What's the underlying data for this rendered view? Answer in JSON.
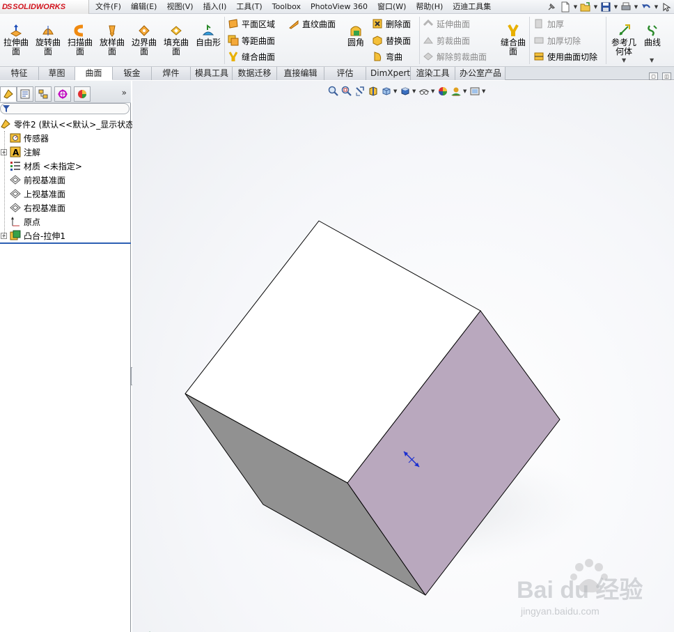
{
  "app": {
    "brand_prefix": "DS",
    "brand_name": "SOLIDWORKS"
  },
  "menus": [
    "文件(F)",
    "编辑(E)",
    "视图(V)",
    "插入(I)",
    "工具(T)",
    "Toolbox",
    "PhotoView 360",
    "窗口(W)",
    "帮助(H)",
    "迈迪工具集"
  ],
  "ribbon": {
    "big_buttons": [
      {
        "label": "拉伸曲面",
        "icon": "extruded-surface-icon"
      },
      {
        "label": "旋转曲面",
        "icon": "revolved-surface-icon"
      },
      {
        "label": "扫描曲面",
        "icon": "swept-surface-icon"
      },
      {
        "label": "放样曲面",
        "icon": "lofted-surface-icon"
      },
      {
        "label": "边界曲面",
        "icon": "boundary-surface-icon"
      },
      {
        "label": "填充曲面",
        "icon": "filled-surface-icon"
      },
      {
        "label": "自由形",
        "icon": "freeform-icon"
      }
    ],
    "group2": [
      {
        "label": "平面区域",
        "icon": "planar-surface-icon"
      },
      {
        "label": "等距曲面",
        "icon": "offset-surface-icon"
      },
      {
        "label": "缝合曲面",
        "icon": "knit-surface-icon"
      }
    ],
    "ruled_surface": "直纹曲面",
    "fillet": "圆角",
    "group3": [
      {
        "label": "删除面",
        "icon": "delete-face-icon"
      },
      {
        "label": "替换面",
        "icon": "replace-face-icon"
      },
      {
        "label": "弯曲",
        "icon": "flex-icon"
      }
    ],
    "group4": [
      {
        "label": "延伸曲面",
        "icon": "extend-surface-icon"
      },
      {
        "label": "剪裁曲面",
        "icon": "trim-surface-icon"
      },
      {
        "label": "解除剪裁曲面",
        "icon": "untrim-surface-icon"
      }
    ],
    "knit_big": "缝合曲面",
    "group5": [
      {
        "label": "加厚",
        "icon": "thicken-icon"
      },
      {
        "label": "加厚切除",
        "icon": "thickened-cut-icon"
      },
      {
        "label": "使用曲面切除",
        "icon": "surface-cut-icon"
      }
    ],
    "ref_geometry": "参考几何体",
    "curves": "曲线"
  },
  "tabs": [
    "特征",
    "草图",
    "曲面",
    "钣金",
    "焊件",
    "模具工具",
    "数据迁移",
    "直接编辑",
    "评估",
    "DimXpert",
    "渲染工具",
    "办公室产品"
  ],
  "active_tab": "曲面",
  "tree": {
    "root": "零件2 (默认<<默认>_显示状态",
    "items": [
      {
        "label": "传感器",
        "icon": "sensor-icon",
        "expandable": false
      },
      {
        "label": "注解",
        "icon": "annotations-icon",
        "expandable": true
      },
      {
        "label": "材质 <未指定>",
        "icon": "material-icon",
        "expandable": false
      },
      {
        "label": "前视基准面",
        "icon": "plane-icon",
        "expandable": false
      },
      {
        "label": "上视基准面",
        "icon": "plane-icon",
        "expandable": false
      },
      {
        "label": "右视基准面",
        "icon": "plane-icon",
        "expandable": false
      },
      {
        "label": "原点",
        "icon": "origin-icon",
        "expandable": false
      },
      {
        "label": "凸台-拉伸1",
        "icon": "boss-extrude-icon",
        "expandable": true
      }
    ]
  },
  "colors": {
    "cube_top": "#ffffff",
    "cube_right": "#b9a8be",
    "cube_left": "#919191",
    "rollback_bar": "#2c5fb3"
  },
  "watermark": {
    "logo_text": "Bai du 经验",
    "url": "jingyan.baidu.com"
  }
}
